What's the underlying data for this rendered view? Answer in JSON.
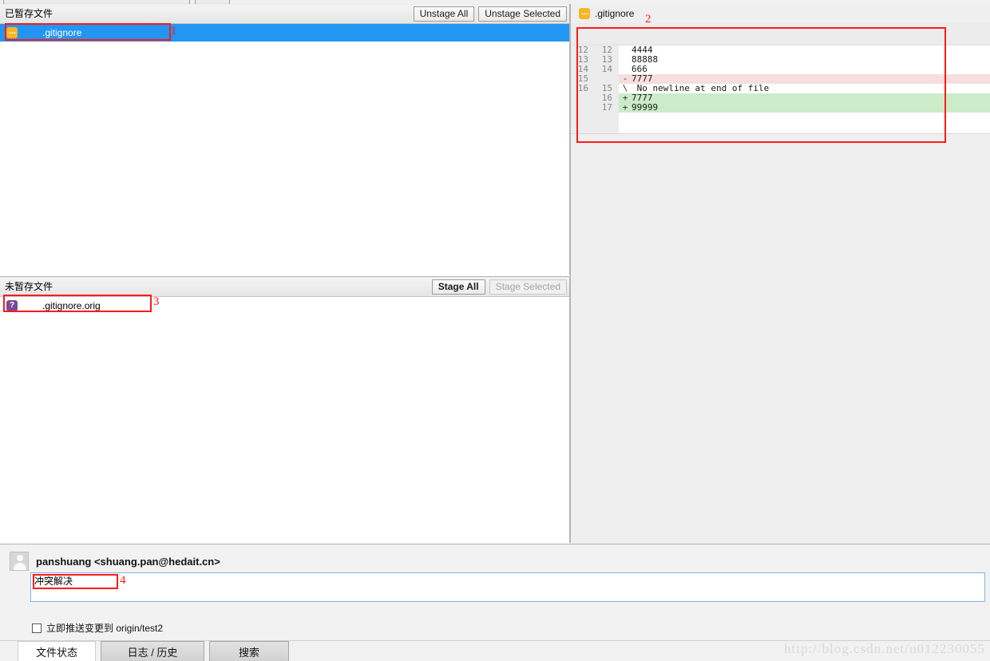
{
  "app": {
    "watermark": "http://blog.csdn.net/u012230055"
  },
  "staged": {
    "title": "已暂存文件",
    "unstage_all_label": "Unstage All",
    "unstage_selected_label": "Unstage Selected",
    "files": [
      {
        "name": ".gitignore",
        "status": "modified",
        "icon": "modified-file-icon",
        "selected": true
      }
    ]
  },
  "unstaged": {
    "title": "未暂存文件",
    "stage_all_label": "Stage All",
    "stage_selected_label": "Stage Selected",
    "stage_selected_disabled": true,
    "files": [
      {
        "name": ".gitignore.orig",
        "status": "untracked",
        "icon": "untracked-file-icon",
        "selected": false
      }
    ]
  },
  "diff": {
    "file_name": ".gitignore",
    "file_icon": "modified-file-icon",
    "lines": [
      {
        "old": "12",
        "new": "12",
        "marker": "",
        "code": "4444",
        "type": "context"
      },
      {
        "old": "13",
        "new": "13",
        "marker": "",
        "code": "88888",
        "type": "context"
      },
      {
        "old": "14",
        "new": "14",
        "marker": "",
        "code": "666",
        "type": "context"
      },
      {
        "old": "15",
        "new": "",
        "marker": "-",
        "code": "7777",
        "type": "deleted"
      },
      {
        "old": "16",
        "new": "15",
        "marker": "\\",
        "code": " No newline at end of file",
        "type": "nonewline"
      },
      {
        "old": "",
        "new": "16",
        "marker": "+",
        "code": "7777",
        "type": "added"
      },
      {
        "old": "",
        "new": "17",
        "marker": "+",
        "code": "99999",
        "type": "added"
      }
    ]
  },
  "commit": {
    "author": "panshuang <shuang.pan@hedait.cn>",
    "message": "冲突解决",
    "placeholder": "",
    "push_checkbox_label": "立即推送变更到 origin/test2",
    "push_checked": false
  },
  "tabs": [
    {
      "label": "文件状态",
      "active": true
    },
    {
      "label": "日志 / 历史",
      "active": false
    },
    {
      "label": "搜索",
      "active": false
    }
  ],
  "annotations": [
    {
      "num": "1"
    },
    {
      "num": "2"
    },
    {
      "num": "3"
    },
    {
      "num": "4"
    }
  ]
}
